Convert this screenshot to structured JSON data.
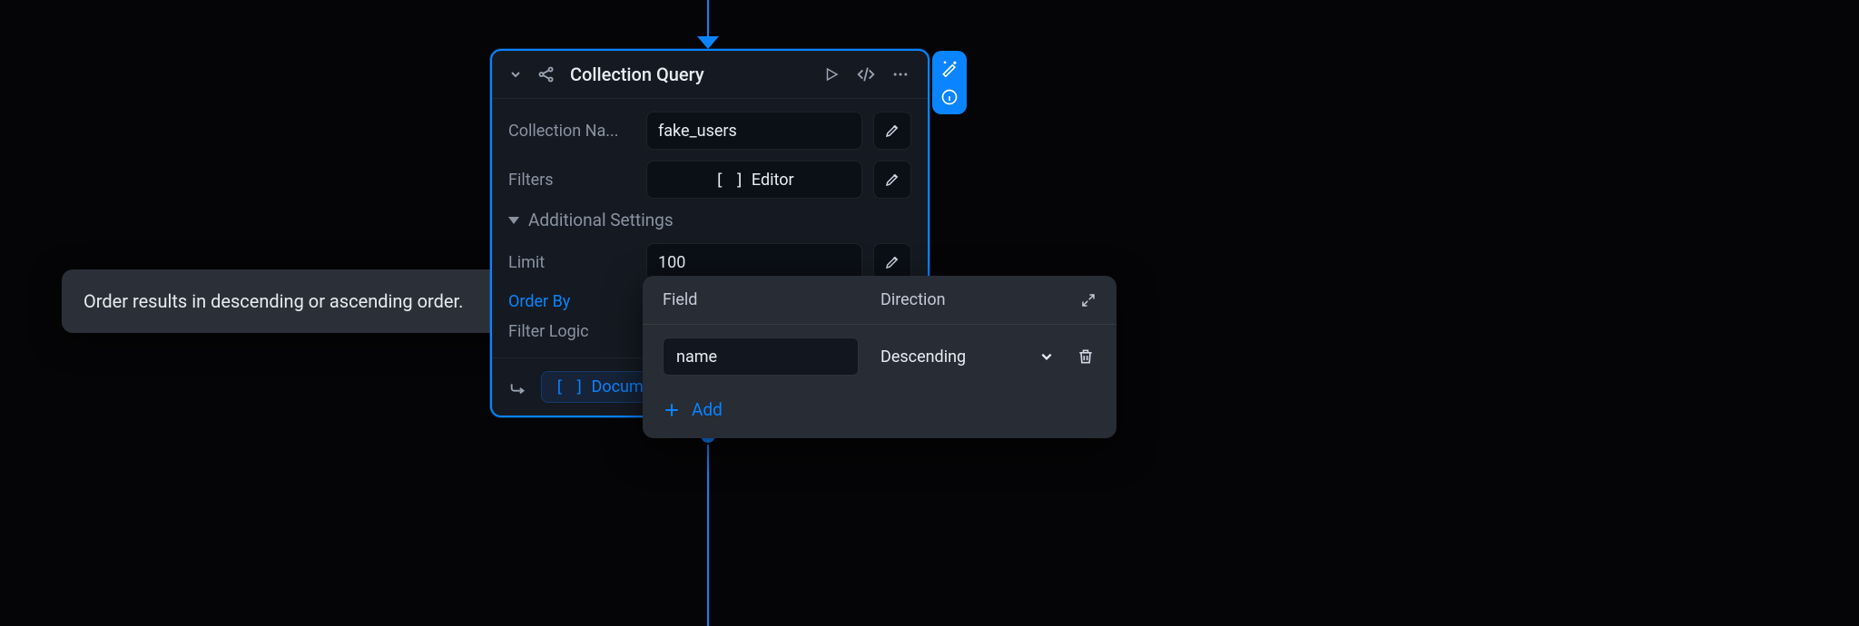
{
  "tooltip": {
    "text": "Order results in descending or ascending order."
  },
  "node": {
    "title": "Collection Query",
    "fields": {
      "collection_name": {
        "label": "Collection Na...",
        "value": "fake_users"
      },
      "filters": {
        "label": "Filters",
        "button": "Editor"
      },
      "additional": {
        "label": "Additional Settings"
      },
      "limit": {
        "label": "Limit",
        "value": "100"
      },
      "order_by": {
        "label": "Order By"
      },
      "filter_logic": {
        "label": "Filter Logic"
      }
    },
    "output_chip": "Docume"
  },
  "popover": {
    "headers": {
      "field": "Field",
      "direction": "Direction"
    },
    "row": {
      "field_value": "name",
      "direction_value": "Descending"
    },
    "add_label": "Add"
  }
}
